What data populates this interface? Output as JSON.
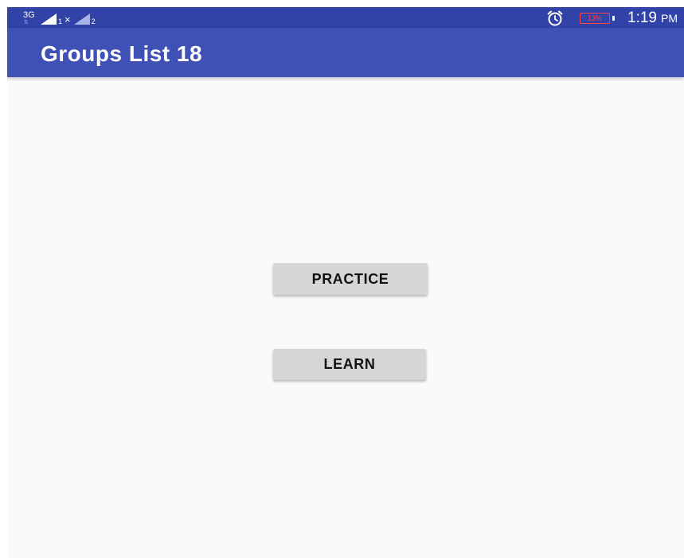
{
  "status_bar": {
    "network_type": "3G",
    "network_arrows": "⇅",
    "sim1_label": "1",
    "sim1_roaming": "×",
    "sim2_label": "2",
    "battery_percent": "13%",
    "time": "1:19",
    "ampm": "PM",
    "icons": [
      "signal-icon",
      "alarm-icon",
      "battery-icon"
    ],
    "background_color": "#3143a7"
  },
  "app_bar": {
    "title": "Groups List 18",
    "background_color": "#3f51b5"
  },
  "main": {
    "buttons": [
      {
        "label": "PRACTICE"
      },
      {
        "label": "LEARN"
      }
    ],
    "background_color": "#fafafa",
    "button_color": "#d6d6d6"
  }
}
